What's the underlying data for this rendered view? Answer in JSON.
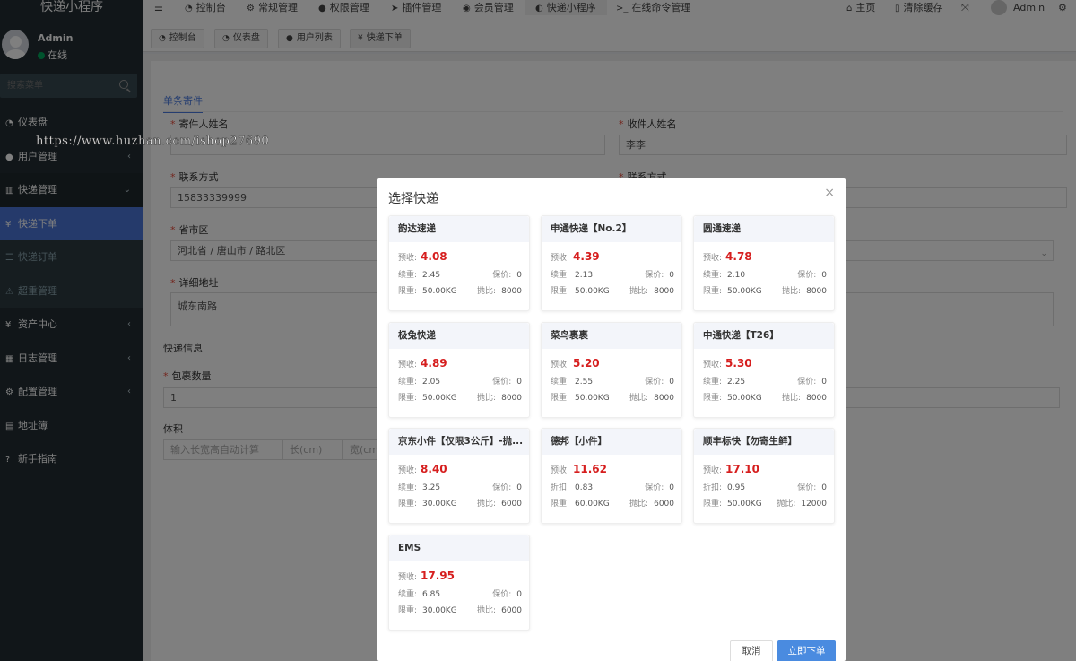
{
  "sidebar": {
    "brand": "快递小程序",
    "user": {
      "name": "Admin",
      "status": "在线"
    },
    "search_placeholder": "搜索菜单",
    "items": [
      {
        "label": "仪表盘",
        "icon": "dashboard-icon"
      },
      {
        "label": "用户管理",
        "icon": "user-icon"
      },
      {
        "label": "快递管理",
        "icon": "list-icon"
      },
      {
        "label": "快递下单",
        "icon": "yen-icon"
      },
      {
        "label": "快递订单",
        "icon": "list-icon"
      },
      {
        "label": "超重管理",
        "icon": "warning-icon"
      },
      {
        "label": "资产中心",
        "icon": "yen-icon"
      },
      {
        "label": "日志管理",
        "icon": "calendar-icon"
      },
      {
        "label": "配置管理",
        "icon": "gear-icon"
      },
      {
        "label": "地址簿",
        "icon": "book-icon"
      },
      {
        "label": "新手指南",
        "icon": "question-icon"
      }
    ]
  },
  "topnav": {
    "items": [
      "控制台",
      "常规管理",
      "权限管理",
      "插件管理",
      "会员管理",
      "快递小程序",
      "在线命令管理"
    ],
    "home": "主页",
    "clear_cache": "清除缓存",
    "admin": "Admin"
  },
  "tabs": [
    "控制台",
    "仪表盘",
    "用户列表",
    "快递下单"
  ],
  "form": {
    "tab": "单条寄件",
    "sender_name_label": "寄件人姓名",
    "receiver_name_label": "收件人姓名",
    "receiver_name_value": "李李",
    "contact_label": "联系方式",
    "contact_label_2": "联系方式",
    "contact_value": "15833339999",
    "region_label": "省市区",
    "region_value": "河北省 / 唐山市 / 路北区",
    "address_label": "详细地址",
    "address_value": "城东南路",
    "express_info_label": "快递信息",
    "package_count_label": "包裹数量",
    "package_count_value": "1",
    "volume_label": "体积",
    "volume_placeholder": "输入长宽高自动计算",
    "length_placeholder": "长(cm)",
    "width_placeholder": "宽(cm)"
  },
  "watermark": "https://www.huzhan.com/ishop27690",
  "modal": {
    "title": "选择快递",
    "cancel": "取消",
    "submit": "立即下单",
    "labels": {
      "estimate": "预收:",
      "weight": "续重:",
      "discount": "折扣:",
      "insure": "保价:",
      "limit": "限重:",
      "ratio": "抛比:"
    },
    "carriers": [
      {
        "name": "韵达速递",
        "price": "4.08",
        "rate_label": "续重:",
        "rate": "2.45",
        "insure": "0",
        "limit": "50.00KG",
        "ratio": "8000"
      },
      {
        "name": "申通快递【No.2】",
        "price": "4.39",
        "rate_label": "续重:",
        "rate": "2.13",
        "insure": "0",
        "limit": "50.00KG",
        "ratio": "8000"
      },
      {
        "name": "圆通速递",
        "price": "4.78",
        "rate_label": "续重:",
        "rate": "2.10",
        "insure": "0",
        "limit": "50.00KG",
        "ratio": "8000"
      },
      {
        "name": "极兔快递",
        "price": "4.89",
        "rate_label": "续重:",
        "rate": "2.05",
        "insure": "0",
        "limit": "50.00KG",
        "ratio": "8000"
      },
      {
        "name": "菜鸟裹裹",
        "price": "5.20",
        "rate_label": "续重:",
        "rate": "2.55",
        "insure": "0",
        "limit": "50.00KG",
        "ratio": "8000"
      },
      {
        "name": "中通快递【T26】",
        "price": "5.30",
        "rate_label": "续重:",
        "rate": "2.25",
        "insure": "0",
        "limit": "50.00KG",
        "ratio": "8000"
      },
      {
        "name": "京东小件【仅限3公斤】-抛...",
        "price": "8.40",
        "rate_label": "续重:",
        "rate": "3.25",
        "insure": "0",
        "limit": "30.00KG",
        "ratio": "6000"
      },
      {
        "name": "德邦【小件】",
        "price": "11.62",
        "rate_label": "折扣:",
        "rate": "0.83",
        "insure": "0",
        "limit": "60.00KG",
        "ratio": "6000"
      },
      {
        "name": "顺丰标快【勿寄生鲜】",
        "price": "17.10",
        "rate_label": "折扣:",
        "rate": "0.95",
        "insure": "0",
        "limit": "50.00KG",
        "ratio": "12000"
      },
      {
        "name": "EMS",
        "price": "17.95",
        "rate_label": "续重:",
        "rate": "6.85",
        "insure": "0",
        "limit": "30.00KG",
        "ratio": "6000"
      }
    ]
  },
  "colors": {
    "sidebar_bg": "#222d32",
    "active": "#4a74d6",
    "price": "#d61e1e",
    "primary": "#4a8be0"
  }
}
